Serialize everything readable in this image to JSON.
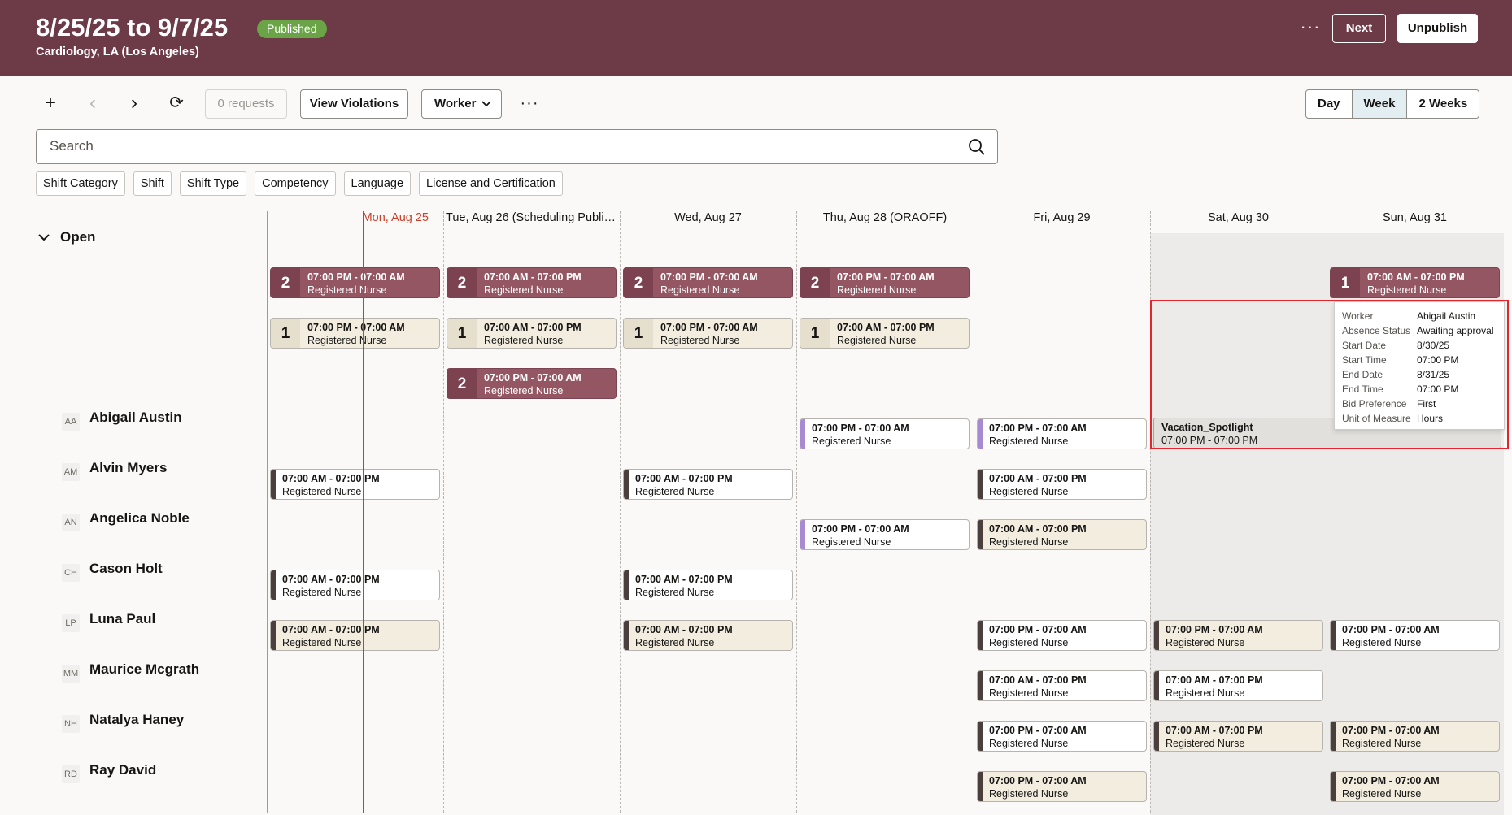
{
  "header": {
    "title": "8/25/25 to 9/7/25",
    "status_badge": "Published",
    "subtitle": "Cardiology, LA (Los Angeles)",
    "more": "···",
    "next_label": "Next",
    "unpublish_label": "Unpublish"
  },
  "toolbar": {
    "add": "+",
    "prev": "‹",
    "next": "›",
    "refresh": "⟳",
    "requests_label": "0 requests",
    "violations_label": "View Violations",
    "worker_label": "Worker",
    "more": "···",
    "views": [
      "Day",
      "Week",
      "2 Weeks"
    ],
    "active_view": "Week"
  },
  "search": {
    "placeholder": "Search"
  },
  "filters": [
    "Shift Category",
    "Shift",
    "Shift Type",
    "Competency",
    "Language",
    "License and Certification"
  ],
  "days": [
    "Mon, Aug 25",
    "Tue, Aug 26 (Scheduling Public ...",
    "Wed, Aug 27",
    "Thu, Aug 28 (ORAOFF)",
    "Fri, Aug 29",
    "Sat, Aug 30",
    "Sun, Aug 31"
  ],
  "open_group": {
    "label": "Open"
  },
  "open_shifts": [
    {
      "count": "2",
      "time": "07:00 PM - 07:00 AM",
      "role": "Registered Nurse"
    },
    {
      "count": "2",
      "time": "07:00 AM - 07:00 PM",
      "role": "Registered Nurse"
    },
    {
      "count": "2",
      "time": "07:00 PM - 07:00 AM",
      "role": "Registered Nurse"
    },
    {
      "count": "2",
      "time": "07:00 PM - 07:00 AM",
      "role": "Registered Nurse"
    },
    {
      "count": "1",
      "time": "07:00 AM - 07:00 PM",
      "role": "Registered Nurse"
    },
    {
      "count": "1",
      "time": "07:00 PM - 07:00 AM",
      "role": "Registered Nurse"
    },
    {
      "count": "1",
      "time": "07:00 AM - 07:00 PM",
      "role": "Registered Nurse"
    },
    {
      "count": "1",
      "time": "07:00 PM - 07:00 AM",
      "role": "Registered Nurse"
    },
    {
      "count": "1",
      "time": "07:00 AM - 07:00 PM",
      "role": "Registered Nurse"
    },
    {
      "count": "2",
      "time": "07:00 PM - 07:00 AM",
      "role": "Registered Nurse"
    }
  ],
  "workers": [
    {
      "initials": "AA",
      "name": "Abigail Austin"
    },
    {
      "initials": "AM",
      "name": "Alvin Myers"
    },
    {
      "initials": "AN",
      "name": "Angelica Noble"
    },
    {
      "initials": "CH",
      "name": "Cason Holt"
    },
    {
      "initials": "LP",
      "name": "Luna Paul"
    },
    {
      "initials": "MM",
      "name": "Maurice Mcgrath"
    },
    {
      "initials": "NH",
      "name": "Natalya Haney"
    },
    {
      "initials": "RD",
      "name": "Ray David"
    }
  ],
  "shifts": [
    {
      "time": "07:00 PM - 07:00 AM",
      "role": "Registered Nurse"
    },
    {
      "time": "07:00 PM - 07:00 AM",
      "role": "Registered Nurse"
    },
    {
      "time": "07:00 AM - 07:00 PM",
      "role": "Registered Nurse"
    },
    {
      "time": "07:00 AM - 07:00 PM",
      "role": "Registered Nurse"
    },
    {
      "time": "07:00 AM - 07:00 PM",
      "role": "Registered Nurse"
    },
    {
      "time": "07:00 PM - 07:00 AM",
      "role": "Registered Nurse"
    },
    {
      "time": "07:00 AM - 07:00 PM",
      "role": "Registered Nurse"
    },
    {
      "time": "07:00 AM - 07:00 PM",
      "role": "Registered Nurse"
    },
    {
      "time": "07:00 AM - 07:00 PM",
      "role": "Registered Nurse"
    },
    {
      "time": "07:00 AM - 07:00 PM",
      "role": "Registered Nurse"
    },
    {
      "time": "07:00 AM - 07:00 PM",
      "role": "Registered Nurse"
    },
    {
      "time": "07:00 PM - 07:00 AM",
      "role": "Registered Nurse"
    },
    {
      "time": "07:00 PM - 07:00 AM",
      "role": "Registered Nurse"
    },
    {
      "time": "07:00 PM - 07:00 AM",
      "role": "Registered Nurse"
    },
    {
      "time": "07:00 AM - 07:00 PM",
      "role": "Registered Nurse"
    },
    {
      "time": "07:00 AM - 07:00 PM",
      "role": "Registered Nurse"
    },
    {
      "time": "07:00 PM - 07:00 AM",
      "role": "Registered Nurse"
    },
    {
      "time": "07:00 AM - 07:00 PM",
      "role": "Registered Nurse"
    },
    {
      "time": "07:00 PM - 07:00 AM",
      "role": "Registered Nurse"
    },
    {
      "time": "07:00 PM - 07:00 AM",
      "role": "Registered Nurse"
    },
    {
      "time": "07:00 PM - 07:00 AM",
      "role": "Registered Nurse"
    },
    {
      "time": "07:00 AM - 07:00 PM",
      "role": "Registered Nurse"
    }
  ],
  "absence": {
    "name": "Vacation_Spotlight",
    "time": "07:00 PM - 07:00 PM"
  },
  "tooltip": [
    {
      "k": "Worker",
      "v": "Abigail Austin"
    },
    {
      "k": "Absence Status",
      "v": "Awaiting approval"
    },
    {
      "k": "Start Date",
      "v": "8/30/25"
    },
    {
      "k": "Start Time",
      "v": "07:00 PM"
    },
    {
      "k": "End Date",
      "v": "8/31/25"
    },
    {
      "k": "End Time",
      "v": "07:00 PM"
    },
    {
      "k": "Bid Preference",
      "v": "First"
    },
    {
      "k": "Unit of Measure",
      "v": "Hours"
    }
  ],
  "colors": {
    "header_bg": "#6d3a48",
    "badge_green": "#6aa447",
    "open_dark": "#935662",
    "open_light": "#f3ede0",
    "today_red": "#c7402a",
    "accent_purple": "#a78ad1",
    "highlight_red": "#e1262d"
  }
}
